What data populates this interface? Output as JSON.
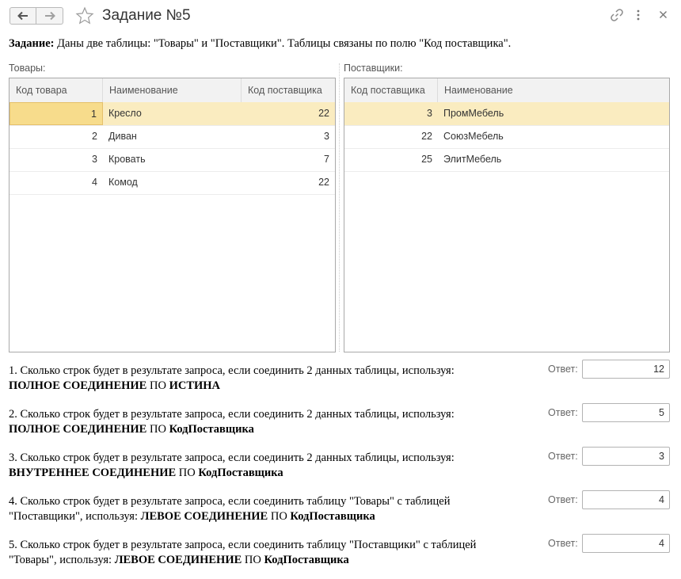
{
  "window": {
    "title": "Задание №5",
    "icons": {
      "back": "arrow-left-icon",
      "forward": "arrow-right-icon",
      "favorite": "star-icon",
      "link": "link-icon",
      "more": "more-vertical-icon",
      "close": "close-icon"
    }
  },
  "task": {
    "label": "Задание:",
    "text": " Даны две таблицы: \"Товары\" и \"Поставщики\". Таблицы связаны по полю \"Код поставщика\"."
  },
  "goods": {
    "label": "Товары:",
    "columns": [
      "Код товара",
      "Наименование",
      "Код поставщика"
    ],
    "rows": [
      {
        "code": "1",
        "name": "Кресло",
        "supplier": "22"
      },
      {
        "code": "2",
        "name": "Диван",
        "supplier": "3"
      },
      {
        "code": "3",
        "name": "Кровать",
        "supplier": "7"
      },
      {
        "code": "4",
        "name": "Комод",
        "supplier": "22"
      }
    ]
  },
  "suppliers": {
    "label": "Поставщики:",
    "columns": [
      "Код поставщика",
      "Наименование"
    ],
    "rows": [
      {
        "code": "3",
        "name": "ПромМебель"
      },
      {
        "code": "22",
        "name": "СоюзМебель"
      },
      {
        "code": "25",
        "name": "ЭлитМебель"
      }
    ]
  },
  "answer_label": "Ответ:",
  "questions": [
    {
      "line1": "1. Сколько строк будет в результате запроса, если соединить 2 данных таблицы, используя:",
      "b1": "ПОЛНОЕ СОЕДИНЕНИЕ",
      "mid": " ПО ",
      "b2": "ИСТИНА",
      "answer": "12"
    },
    {
      "line1": "2. Сколько строк будет в результате запроса, если соединить 2 данных таблицы, используя:",
      "b1": "ПОЛНОЕ СОЕДИНЕНИЕ",
      "mid": " ПО ",
      "b2": "КодПоставщика",
      "answer": "5"
    },
    {
      "line1": "3. Сколько строк будет в результате запроса, если соединить 2 данных таблицы, используя:",
      "b1": "ВНУТРЕННЕЕ СОЕДИНЕНИЕ",
      "mid": " ПО ",
      "b2": "КодПоставщика",
      "answer": "3"
    },
    {
      "line1": "4. Сколько строк будет в результате запроса, если соединить таблицу \"Товары\" с таблицей",
      "pre": "\"Поставщики\", используя: ",
      "b1": "ЛЕВОЕ СОЕДИНЕНИЕ",
      "mid": " ПО ",
      "b2": "КодПоставщика",
      "answer": "4"
    },
    {
      "line1": "5. Сколько строк будет в результате запроса, если соединить таблицу \"Поставщики\" с таблицей",
      "pre": "\"Товары\", используя: ",
      "b1": "ЛЕВОЕ СОЕДИНЕНИЕ",
      "mid": " ПО ",
      "b2": "КодПоставщика",
      "answer": "4"
    }
  ]
}
